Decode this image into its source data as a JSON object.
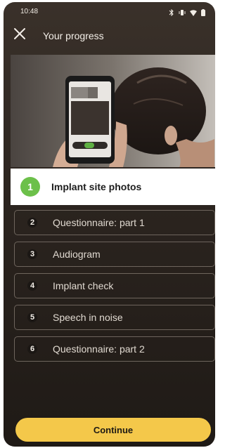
{
  "status_bar": {
    "time": "10:48"
  },
  "header": {
    "title": "Your progress",
    "close_icon": "close-icon"
  },
  "hero": {
    "alt": "Person taking a photo of implant site"
  },
  "progress": {
    "current": {
      "number": "1",
      "label": "Implant site photos"
    },
    "steps": [
      {
        "number": "2",
        "label": "Questionnaire: part 1"
      },
      {
        "number": "3",
        "label": "Audiogram"
      },
      {
        "number": "4",
        "label": "Implant check"
      },
      {
        "number": "5",
        "label": "Speech in noise"
      },
      {
        "number": "6",
        "label": "Questionnaire: part 2"
      }
    ]
  },
  "footer": {
    "continue_label": "Continue"
  },
  "colors": {
    "accent_green": "#6cc04a",
    "button_yellow": "#f4c84a"
  }
}
